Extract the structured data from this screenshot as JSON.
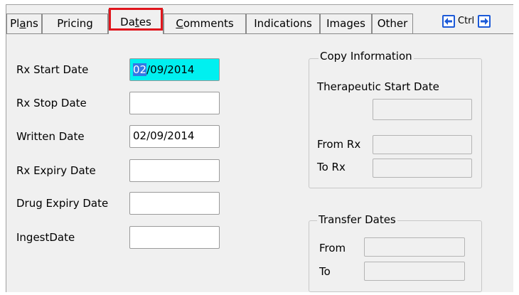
{
  "tabs": [
    {
      "pre": "Pl",
      "u": "a",
      "post": "ns"
    },
    {
      "pre": "Pricing",
      "u": "",
      "post": ""
    },
    {
      "pre": "Da",
      "u": "t",
      "post": "es"
    },
    {
      "pre": "",
      "u": "C",
      "post": "omments"
    },
    {
      "pre": "Indications",
      "u": "",
      "post": ""
    },
    {
      "pre": "Images",
      "u": "",
      "post": ""
    },
    {
      "pre": "Other",
      "u": "",
      "post": ""
    }
  ],
  "active_tab": "Dates",
  "nav": {
    "ctrl_label": "Ctrl",
    "prev_icon": "arrow-left-icon",
    "next_icon": "arrow-right-icon"
  },
  "dates": {
    "rx_start": {
      "label": "Rx Start Date",
      "value_selected": "02",
      "value_rest": "/09/2014"
    },
    "rx_stop": {
      "label": "Rx Stop Date",
      "value": ""
    },
    "written": {
      "label": "Written Date",
      "value": "02/09/2014"
    },
    "rx_expiry": {
      "label": "Rx Expiry Date",
      "value": ""
    },
    "drug_expiry": {
      "label": "Drug Expiry Date",
      "value": ""
    },
    "ingest": {
      "label": "IngestDate",
      "value": ""
    }
  },
  "copy_info": {
    "title": "Copy Information",
    "therapeutic_start_label": "Therapeutic Start Date",
    "therapeutic_start_value": "",
    "from_rx_label": "From Rx",
    "from_rx_value": "",
    "to_rx_label": "To Rx",
    "to_rx_value": ""
  },
  "transfer": {
    "title": "Transfer Dates",
    "from_label": "From",
    "from_value": "",
    "to_label": "To",
    "to_value": ""
  },
  "colors": {
    "focus_bg": "#00f0f0",
    "highlight_border": "#e0151c",
    "selection": "#3478e5",
    "nav_blue": "#1c5ad8"
  }
}
